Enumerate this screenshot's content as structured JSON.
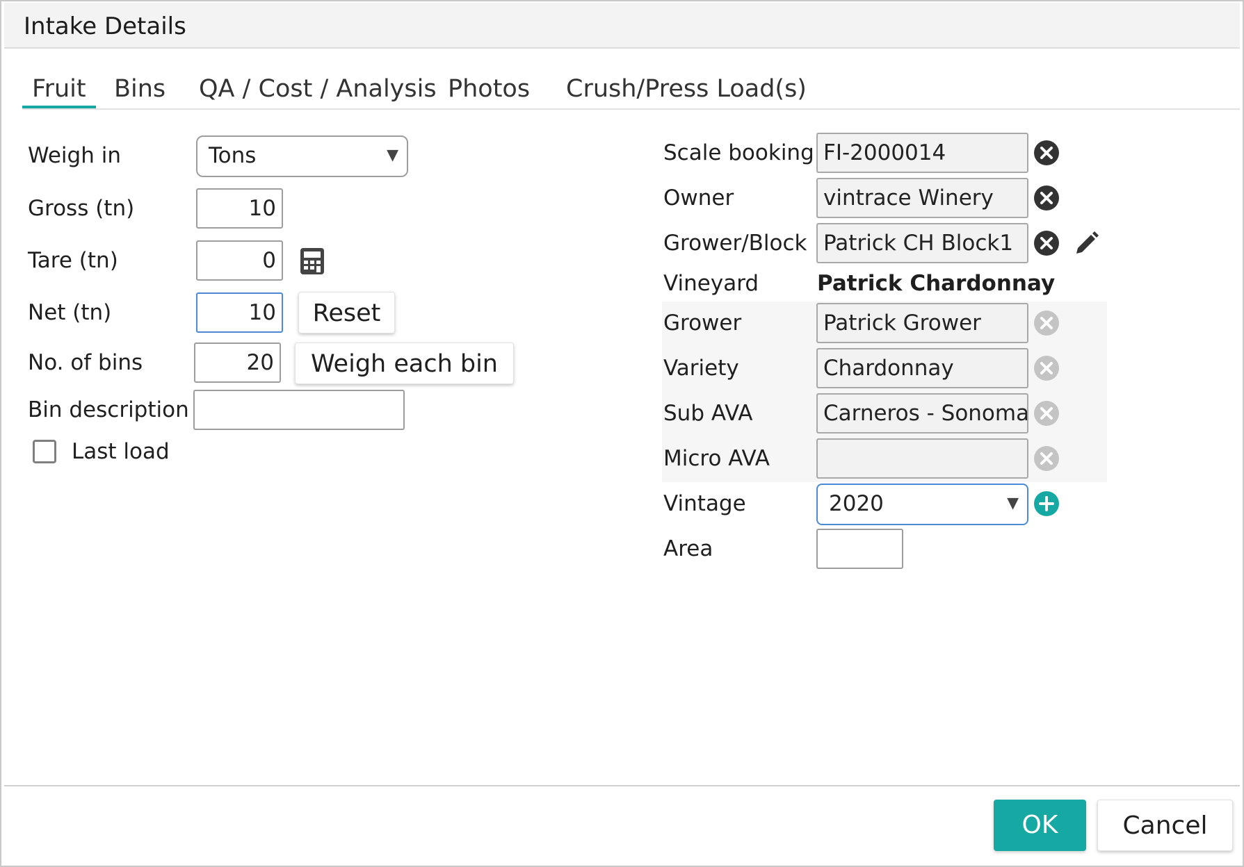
{
  "dialog": {
    "title": "Intake Details"
  },
  "tabs": [
    {
      "label": "Fruit",
      "active": true
    },
    {
      "label": "Bins"
    },
    {
      "label": "QA / Cost / Analysis"
    },
    {
      "label": "Photos"
    },
    {
      "label": "Crush/Press Load(s)"
    }
  ],
  "left": {
    "weigh_in": {
      "label": "Weigh in",
      "value": "Tons"
    },
    "gross": {
      "label": "Gross (tn)",
      "value": "10"
    },
    "tare": {
      "label": "Tare (tn)",
      "value": "0"
    },
    "net": {
      "label": "Net (tn)",
      "value": "10",
      "reset_label": "Reset"
    },
    "bins": {
      "label": "No. of bins",
      "value": "20",
      "weigh_each_label": "Weigh each bin"
    },
    "bin_description": {
      "label": "Bin description",
      "value": ""
    },
    "last_load": {
      "label": "Last load",
      "checked": false
    }
  },
  "right": {
    "scale_booking": {
      "label": "Scale booking",
      "value": "FI-2000014"
    },
    "owner": {
      "label": "Owner",
      "value": "vintrace Winery"
    },
    "grower_block": {
      "label": "Grower/Block",
      "value": "Patrick CH Block1"
    },
    "vineyard": {
      "label": "Vineyard",
      "value": "Patrick Chardonnay"
    },
    "grower": {
      "label": "Grower",
      "value": "Patrick Grower"
    },
    "variety": {
      "label": "Variety",
      "value": "Chardonnay"
    },
    "sub_ava": {
      "label": "Sub AVA",
      "value": "Carneros - Sonoma"
    },
    "micro_ava": {
      "label": "Micro AVA",
      "value": ""
    },
    "vintage": {
      "label": "Vintage",
      "value": "2020"
    },
    "area": {
      "label": "Area",
      "value": ""
    }
  },
  "footer": {
    "ok_label": "OK",
    "cancel_label": "Cancel"
  },
  "colors": {
    "accent": "#16a8a2",
    "focus_border": "#4c8ad6",
    "clear_icon_dark": "#333333",
    "clear_icon_disabled": "#c4c4c4"
  }
}
